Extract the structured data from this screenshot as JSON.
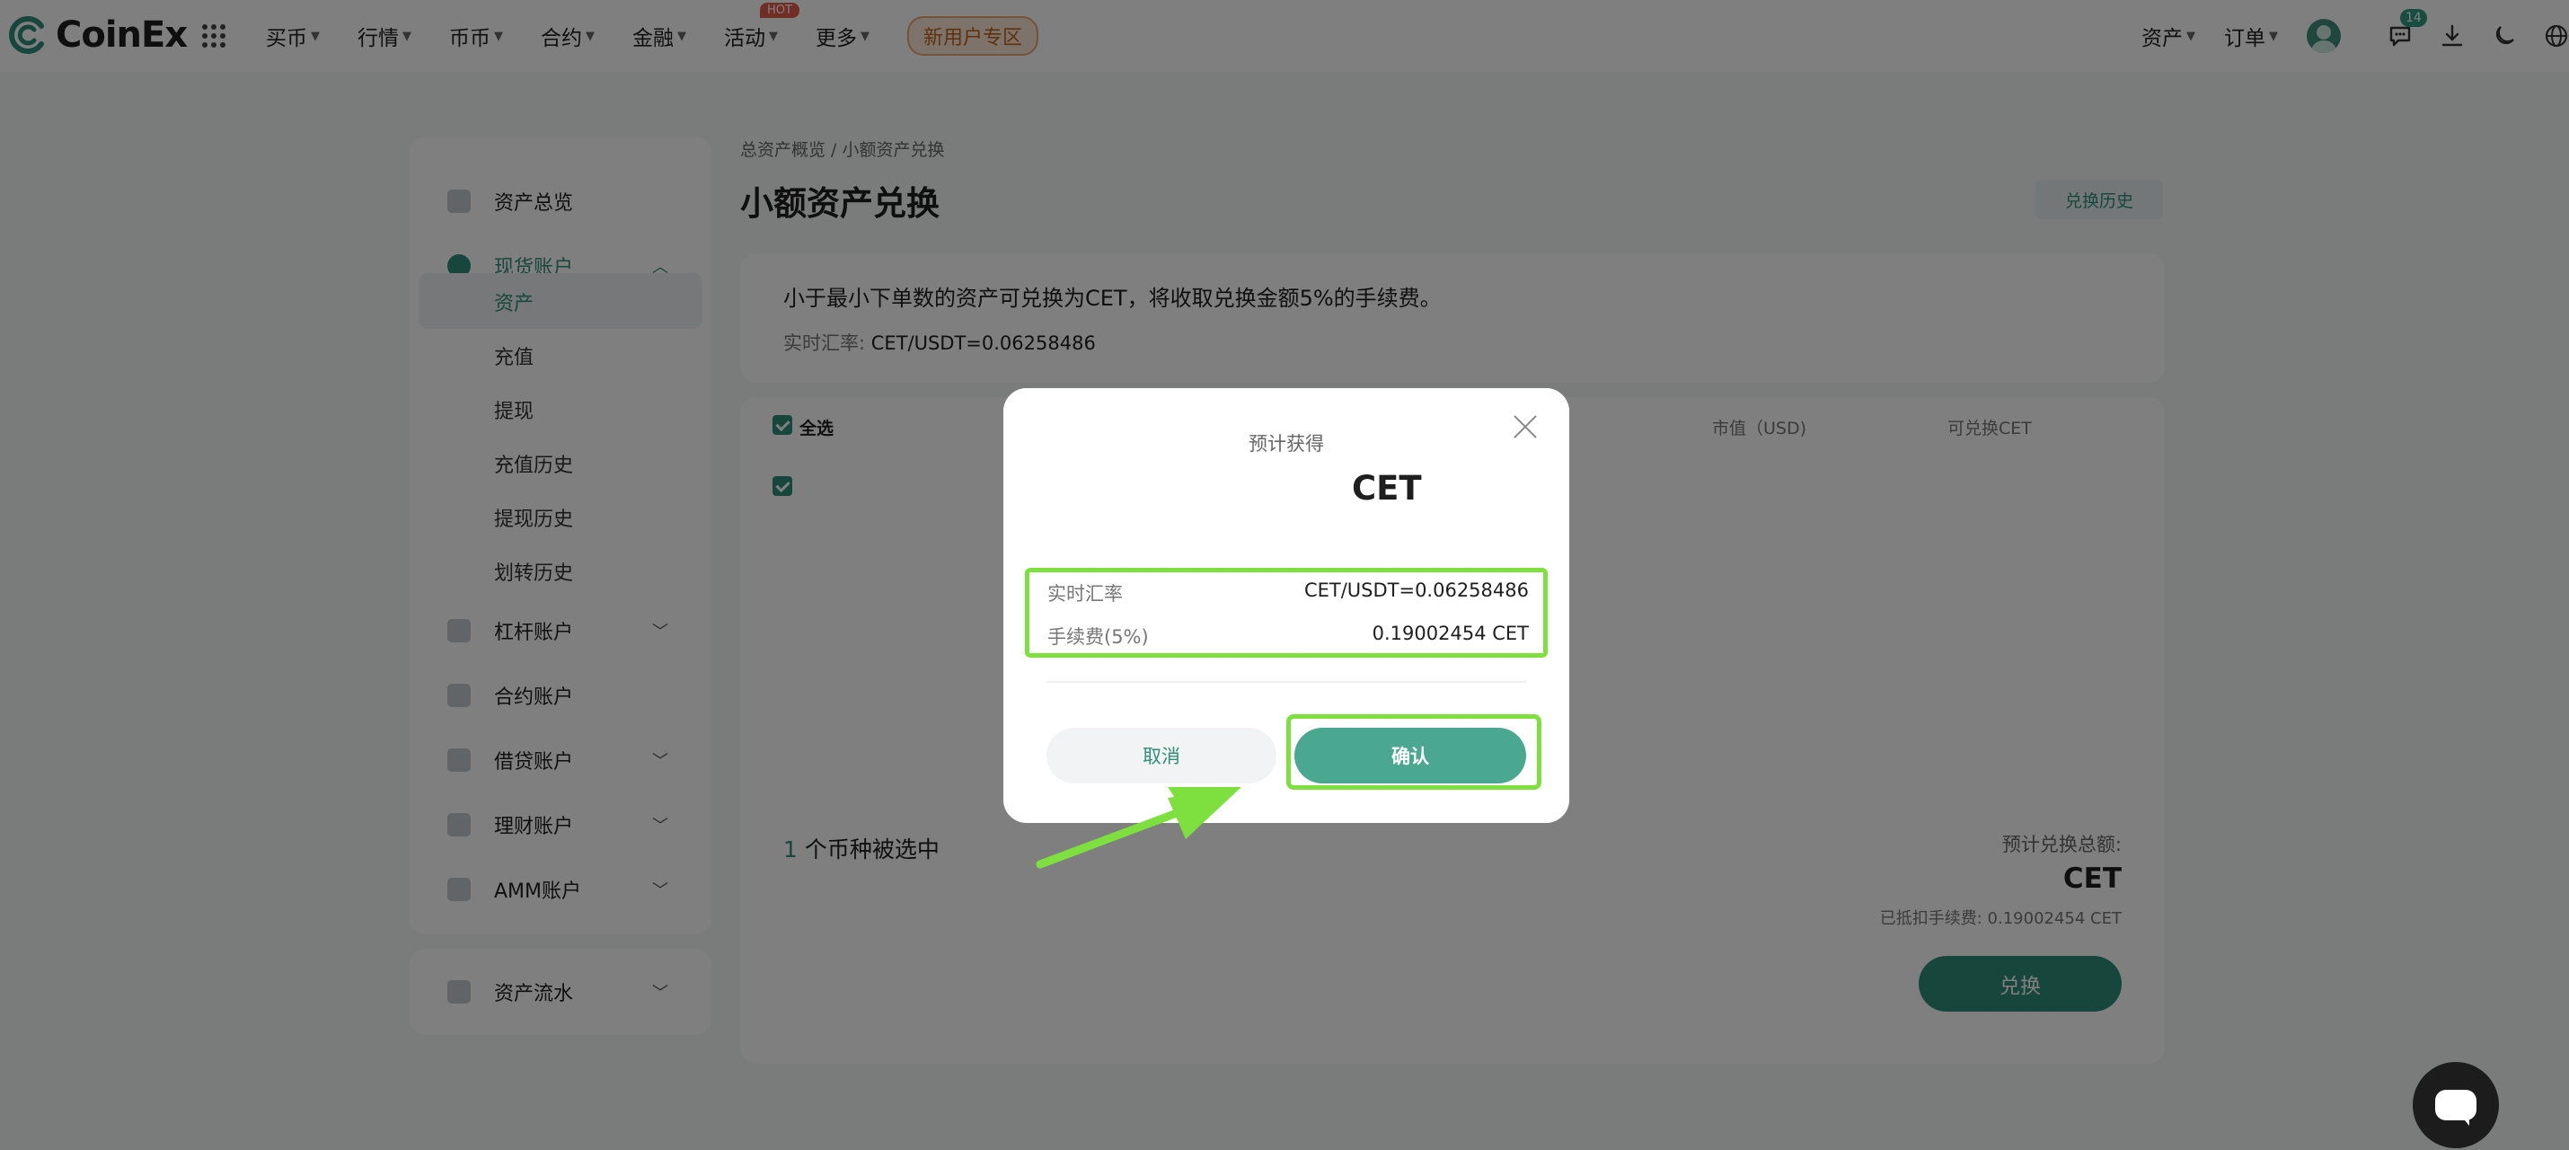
{
  "brand": {
    "name": "CoinEx",
    "accent": "#2e8f78",
    "highlight": "#7ee03f"
  },
  "topnav": {
    "items": [
      {
        "label": "买币"
      },
      {
        "label": "行情"
      },
      {
        "label": "币币"
      },
      {
        "label": "合约"
      },
      {
        "label": "金融"
      },
      {
        "label": "活动",
        "badge": "HOT"
      },
      {
        "label": "更多"
      }
    ],
    "promo": "新用户专区",
    "right": {
      "assets": "资产",
      "orders": "订单",
      "message_count": "14"
    }
  },
  "sidebar": {
    "overview": "资产总览",
    "spot": "现货账户",
    "spot_sub": [
      "资产",
      "充值",
      "提现",
      "充值历史",
      "提现历史",
      "划转历史"
    ],
    "margin": "杠杆账户",
    "futures": "合约账户",
    "loan": "借贷账户",
    "finance": "理财账户",
    "amm": "AMM账户",
    "flow": "资产流水"
  },
  "main": {
    "breadcrumb": "总资产概览  /  小额资产兑换",
    "title": "小额资产兑换",
    "history_button": "兑换历史",
    "info_text": "小于最小下单数的资产可兑换为CET，将收取兑换金额5%的手续费。",
    "rate_label": "实时汇率: ",
    "rate_value": "CET/USDT=0.06258486",
    "table": {
      "select_all": "全选",
      "col_market_value": "市值（USD)",
      "col_convertible": "可兑换CET"
    },
    "selected_count": "1",
    "selected_suffix": " 个币种被选中",
    "estimated_total_label": "预计兑换总额:",
    "estimated_total_unit": "CET",
    "fee_deducted": "已抵扣手续费: 0.19002454 CET",
    "convert_button": "兑换"
  },
  "modal": {
    "subtitle": "预计获得",
    "amount_unit": "CET",
    "rate_key": "实时汇率",
    "rate_value": "CET/USDT=0.06258486",
    "fee_key": "手续费(5%)",
    "fee_value": "0.19002454 CET",
    "cancel": "取消",
    "confirm": "确认"
  }
}
